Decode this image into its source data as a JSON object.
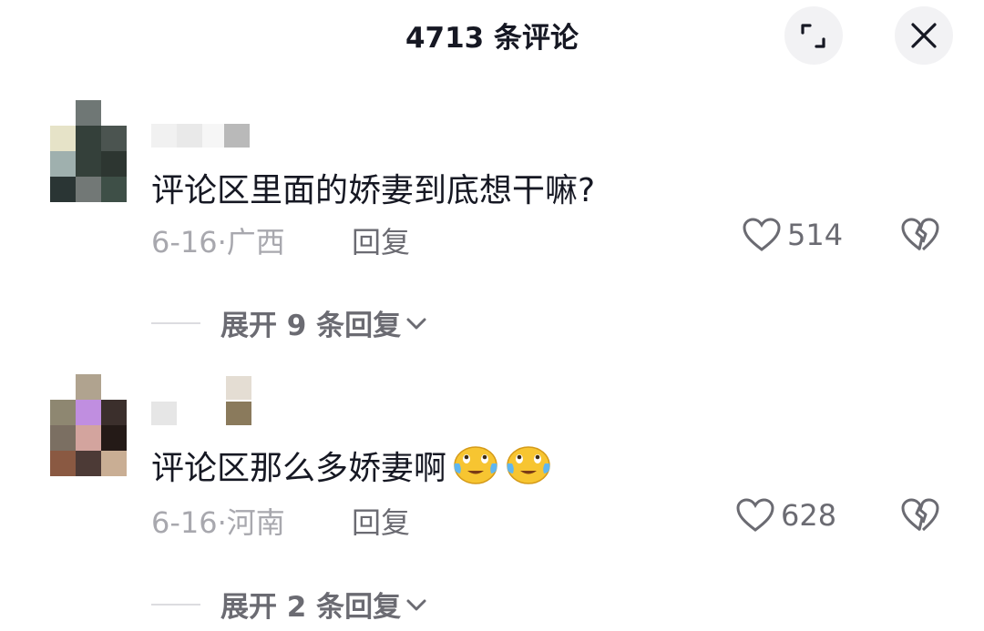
{
  "header": {
    "title": "4713 条评论"
  },
  "comments": [
    {
      "text": "评论区里面的娇妻到底想干嘛?",
      "date": "6-16",
      "region": "广西",
      "reply_label": "回复",
      "likes": "514",
      "expand_label": "展开 9 条回复",
      "avatar_colors": [
        "#ffffff",
        "#6f7775",
        "#ffffff",
        "#e6e3c8",
        "#34403a",
        "#4b5450",
        "#9fb0ae",
        "#34403a",
        "#2d3631",
        "#2a3534",
        "#727876",
        "#3e4f47"
      ]
    },
    {
      "text": "评论区那么多娇妻啊",
      "emojis": [
        "tears-of-joy-emoji",
        "tears-of-joy-emoji"
      ],
      "date": "6-16",
      "region": "河南",
      "reply_label": "回复",
      "likes": "628",
      "expand_label": "展开 2 条回复",
      "avatar_colors": [
        "#ffffff",
        "#b0a38f",
        "#ffffff",
        "#8e8771",
        "#c08ee0",
        "#3b2f2c",
        "#7b6f62",
        "#d3a49e",
        "#241a17",
        "#8a5942",
        "#4c3a36",
        "#c9ae94"
      ]
    }
  ],
  "colors": {
    "text_primary": "#161823",
    "text_secondary": "#6b6b72",
    "text_meta": "#a8a8ae",
    "button_bg": "#f2f2f4"
  }
}
